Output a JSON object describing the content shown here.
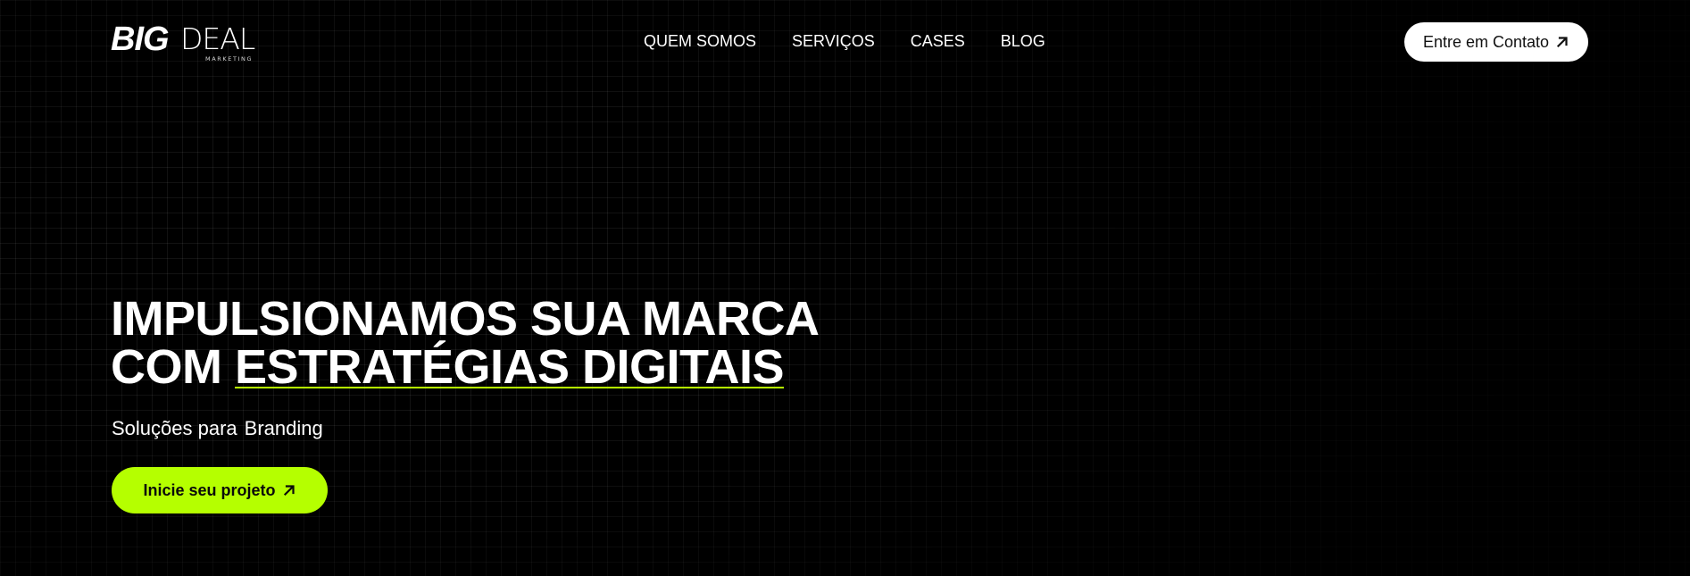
{
  "brand": {
    "logo_main": "BIG",
    "logo_secondary": "DEAL",
    "logo_tagline": "MARKETING"
  },
  "nav": {
    "items": [
      {
        "label": "QUEM SOMOS"
      },
      {
        "label": "SERVIÇOS"
      },
      {
        "label": "CASES"
      },
      {
        "label": "BLOG"
      }
    ]
  },
  "header": {
    "contact_label": "Entre em Contato",
    "contact_icon": "arrow-up-right-icon"
  },
  "hero": {
    "title_line1": "IMPULSIONAMOS SUA MARCA",
    "title_line2_prefix": "COM ",
    "title_line2_highlight": "ESTRATÉGIAS DIGITAIS",
    "subtitle_prefix": "Soluções para",
    "subtitle_rotating_word": "Branding",
    "cta_label": "Inicie seu projeto",
    "cta_icon": "arrow-up-right-icon"
  },
  "colors": {
    "background": "#000000",
    "accent": "#b5ff00",
    "text": "#ffffff",
    "contact_button_bg": "#ffffff"
  }
}
